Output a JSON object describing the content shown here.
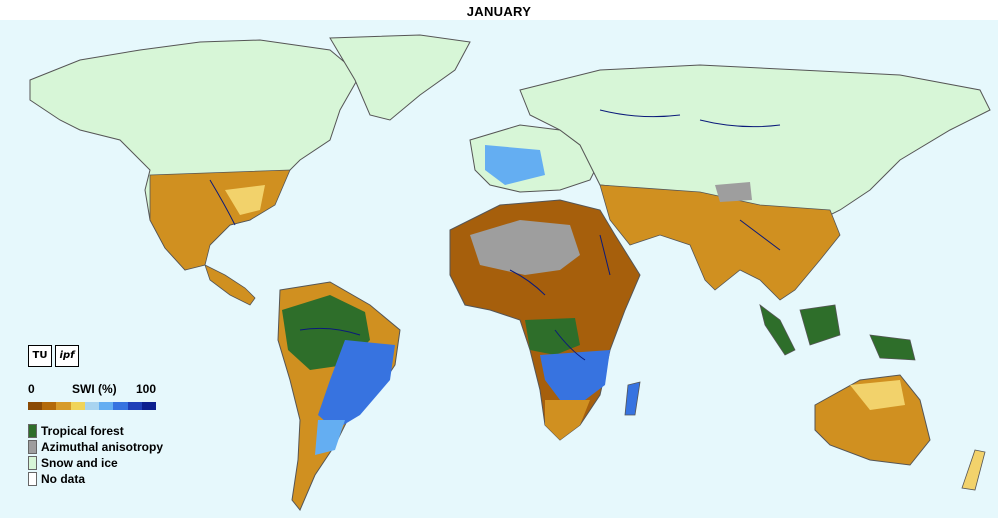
{
  "title": "JANUARY",
  "colors": {
    "ocean": "#e6f8fc",
    "snow_ice": "#d7f6d7",
    "tropical_forest": "#2e6e2a",
    "azimuthal_anisotropy": "#9e9e9e",
    "no_data": "#ffffff",
    "very_dry": "#a65f0c",
    "dry": "#d09020",
    "moderate": "#f2d26b",
    "wet": "#5ea8f0",
    "very_wet": "#1f45c8",
    "boundaries": "#555555",
    "rivers": "#0b1a7a"
  },
  "logos": {
    "tu": "TU",
    "ipf": "ipf"
  },
  "scale": {
    "min_label": "0",
    "label": "SWI (%)",
    "max_label": "100",
    "colors": [
      "#8a4a05",
      "#b36a0a",
      "#d79b2a",
      "#f0d45a",
      "#a8d4f0",
      "#64aef2",
      "#3773e0",
      "#1f3fb8",
      "#0c1f8f"
    ]
  },
  "legend": [
    {
      "label": "Tropical forest",
      "color": "#2e6e2a"
    },
    {
      "label": "Azimuthal anisotropy",
      "color": "#9e9e9e"
    },
    {
      "label": "Snow and ice",
      "color": "#d7f6d7"
    },
    {
      "label": "No data",
      "color": "#ffffff"
    }
  ]
}
